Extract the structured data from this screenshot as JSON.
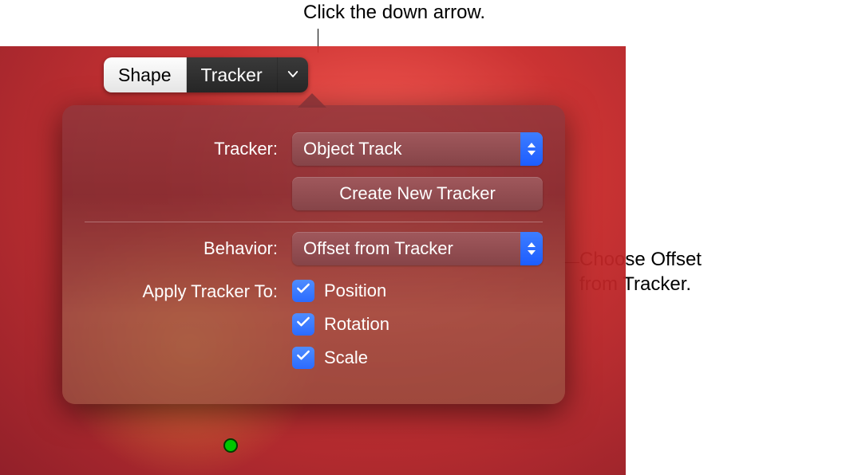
{
  "callouts": {
    "top": "Click the down arrow.",
    "right_line1": "Choose Offset",
    "right_line2": "from Tracker."
  },
  "toolbar": {
    "shape_label": "Shape",
    "tracker_label": "Tracker"
  },
  "popover": {
    "tracker_label": "Tracker:",
    "tracker_value": "Object Track",
    "create_button": "Create New Tracker",
    "behavior_label": "Behavior:",
    "behavior_value": "Offset from Tracker",
    "apply_label": "Apply Tracker To:",
    "checks": [
      {
        "label": "Position",
        "checked": true
      },
      {
        "label": "Rotation",
        "checked": true
      },
      {
        "label": "Scale",
        "checked": true
      }
    ]
  }
}
